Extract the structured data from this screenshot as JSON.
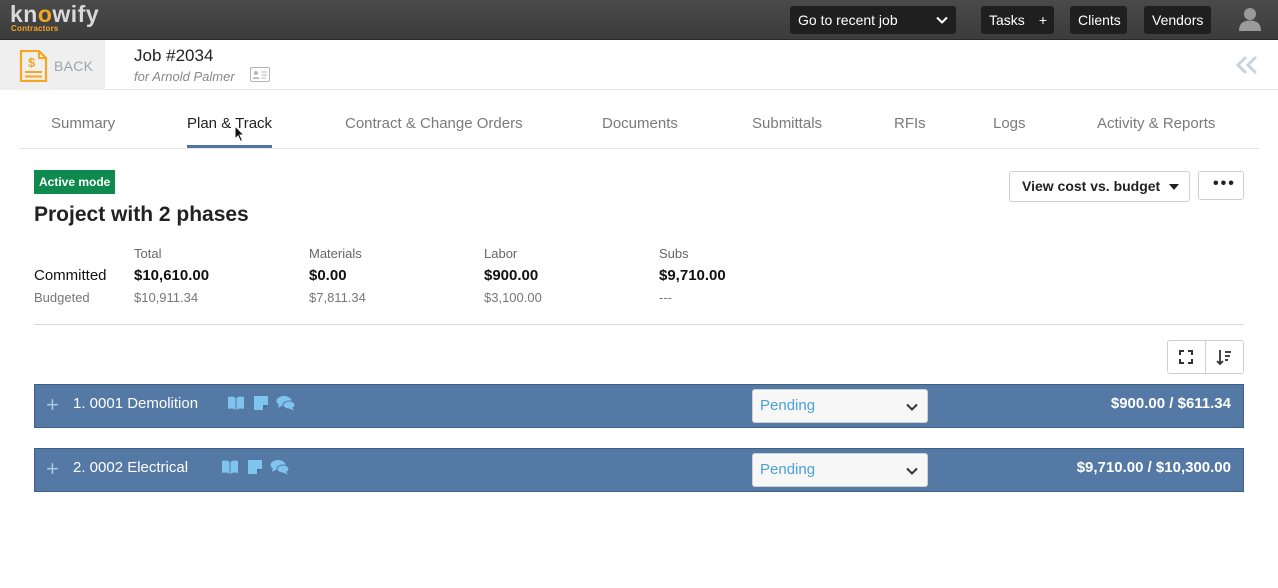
{
  "topbar": {
    "logo_text_a": "kn",
    "logo_text_o": "o",
    "logo_text_b": "wify",
    "logo_sub": "Contractors",
    "recent_job": "Go to recent job",
    "tasks": "Tasks",
    "tasks_plus": "+",
    "clients": "Clients",
    "vendors": "Vendors"
  },
  "job": {
    "back_label": "BACK",
    "title": "Job #2034",
    "subtitle": "for Arnold Palmer"
  },
  "tabs": [
    {
      "label": "Summary",
      "active": false
    },
    {
      "label": "Plan & Track",
      "active": true
    },
    {
      "label": "Contract & Change Orders",
      "active": false
    },
    {
      "label": "Documents",
      "active": false
    },
    {
      "label": "Submittals",
      "active": false
    },
    {
      "label": "RFIs",
      "active": false
    },
    {
      "label": "Logs",
      "active": false
    },
    {
      "label": "Activity & Reports",
      "active": false
    }
  ],
  "content": {
    "mode_badge": "Active mode",
    "project_title": "Project with 2 phases",
    "view_button": "View cost vs. budget",
    "more_button": "•••"
  },
  "summary": {
    "row_committed": "Committed",
    "row_budgeted": "Budgeted",
    "columns": [
      {
        "header": "Total",
        "committed": "$10,610.00",
        "budgeted": "$10,911.34"
      },
      {
        "header": "Materials",
        "committed": "$0.00",
        "budgeted": "$7,811.34"
      },
      {
        "header": "Labor",
        "committed": "$900.00",
        "budgeted": "$3,100.00"
      },
      {
        "header": "Subs",
        "committed": "$9,710.00",
        "budgeted": "---"
      }
    ]
  },
  "phases": [
    {
      "name": "1. 0001 Demolition",
      "status": "Pending",
      "amount": "$900.00 / $611.34"
    },
    {
      "name": "2. 0002 Electrical",
      "status": "Pending",
      "amount": "$9,710.00 / $10,300.00"
    }
  ],
  "colors": {
    "topbar": "#3c3c3c",
    "accent": "#f5a623",
    "phase_bar": "#5479a5",
    "badge": "#0e8a4e",
    "status_text": "#4aa0d8",
    "phase_icon": "#7fc3ef"
  }
}
